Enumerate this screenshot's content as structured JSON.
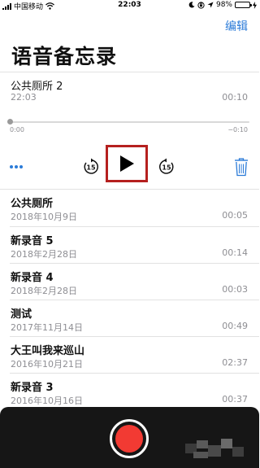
{
  "status_bar": {
    "carrier": "中国移动",
    "time": "22:03",
    "battery": "98%"
  },
  "nav": {
    "edit_label": "编辑",
    "title": "语音备忘录"
  },
  "expanded": {
    "name": "公共厕所 2",
    "time": "22:03",
    "duration": "00:10",
    "elapsed": "0:00",
    "remaining": "−0:10",
    "skip_back_seconds": "15",
    "skip_forward_seconds": "15"
  },
  "recordings": [
    {
      "name": "公共厕所",
      "date": "2018年10月9日",
      "duration": "00:05"
    },
    {
      "name": "新录音 5",
      "date": "2018年2月28日",
      "duration": "00:14"
    },
    {
      "name": "新录音 4",
      "date": "2018年2月28日",
      "duration": "00:03"
    },
    {
      "name": "测试",
      "date": "2017年11月14日",
      "duration": "00:49"
    },
    {
      "name": "大王叫我来巡山",
      "date": "2016年10月21日",
      "duration": "02:37"
    },
    {
      "name": "新录音 3",
      "date": "2016年10月16日",
      "duration": "00:37"
    }
  ],
  "colors": {
    "accent": "#2b7bd8",
    "highlight_box": "#b5201f",
    "record": "#f23a33",
    "battery": "#3ec94b"
  }
}
